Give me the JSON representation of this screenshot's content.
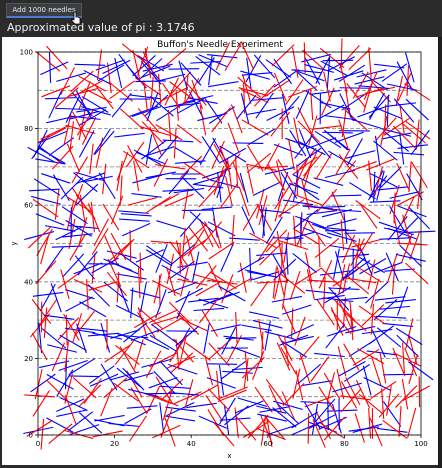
{
  "toolbar": {
    "add_button_label": "Add 1000 needles"
  },
  "result": {
    "label": "Approximated value of pi : 3.1746"
  },
  "chart_data": {
    "type": "scatter",
    "title": "Buffon's Needle Experiment",
    "xlabel": "x",
    "ylabel": "y",
    "xlim": [
      0,
      100
    ],
    "ylim": [
      0,
      100
    ],
    "xticks": [
      "0",
      "20",
      "40",
      "60",
      "80",
      "100"
    ],
    "yticks": [
      "0",
      "20",
      "40",
      "60",
      "80",
      "100"
    ],
    "floor_lines_y": [
      0,
      10,
      20,
      30,
      40,
      50,
      60,
      70,
      80,
      90,
      100
    ],
    "needle_length": 8,
    "needle_count": 1000,
    "colors": {
      "crossing": "#ff0000",
      "non_crossing": "#0000ff",
      "floor_line": "#808080"
    },
    "grid": false,
    "legend": "none"
  }
}
